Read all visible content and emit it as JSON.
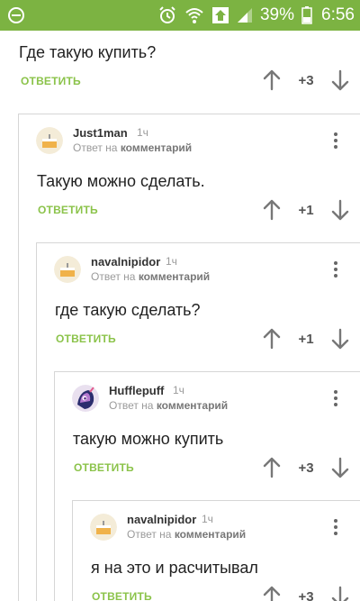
{
  "status_bar": {
    "battery_percent": "39%",
    "time": "6:56",
    "bar_color": "#7cb342"
  },
  "accent_color": "#8bc34a",
  "comments": [
    {
      "text": "Где такую купить?",
      "reply_label": "ОТВЕТИТЬ",
      "score": "+3"
    },
    {
      "author": "Just1man",
      "time": "1ч",
      "reply_to_prefix": "Ответ на",
      "reply_to_target": "комментарий",
      "text": "Такую можно сделать.",
      "reply_label": "ОТВЕТИТЬ",
      "score": "+1",
      "avatar_icon": "cake-avatar-icon"
    },
    {
      "author": "navalnipidor",
      "time": "1ч",
      "reply_to_prefix": "Ответ на",
      "reply_to_target": "комментарий",
      "text": "где такую сделать?",
      "reply_label": "ОТВЕТИТЬ",
      "score": "+1",
      "avatar_icon": "cake-avatar-icon"
    },
    {
      "author": "Hufflepuff",
      "time": "1ч",
      "reply_to_prefix": "Ответ на",
      "reply_to_target": "комментарий",
      "text": "такую можно купить",
      "reply_label": "ОТВЕТИТЬ",
      "score": "+3",
      "avatar_icon": "pony-avatar-icon"
    },
    {
      "author": "navalnipidor",
      "time": "1ч",
      "reply_to_prefix": "Ответ на",
      "reply_to_target": "комментарий",
      "text": "я на это и расчитывал",
      "reply_label": "ОТВЕТИТЬ",
      "score": "+3",
      "avatar_icon": "cake-avatar-icon"
    }
  ]
}
